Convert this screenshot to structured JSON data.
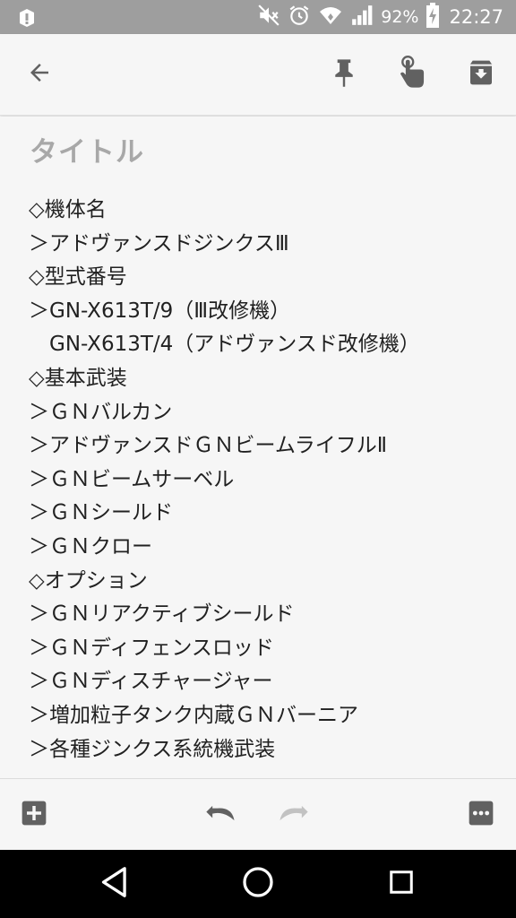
{
  "status_bar": {
    "battery_percent": "92%",
    "time": "22:27",
    "icons": [
      "notification-icon",
      "mute-icon",
      "alarm-icon",
      "wifi-icon",
      "signal-icon",
      "battery-charging-icon"
    ]
  },
  "toolbar": {
    "icons": [
      "back-arrow-icon",
      "pin-icon",
      "reminder-hand-icon",
      "archive-icon"
    ]
  },
  "note": {
    "title_placeholder": "タイトル",
    "lines": [
      "◇機体名",
      "＞アドヴァンスドジンクスⅢ",
      "◇型式番号",
      "＞GN-X613T/9（Ⅲ改修機）",
      "　GN-X613T/4（アドヴァンスド改修機）",
      "◇基本武装",
      "＞ＧＮバルカン",
      "＞アドヴァンスドＧＮビームライフルⅡ",
      "＞ＧＮビームサーベル",
      "＞ＧＮシールド",
      "＞ＧＮクロー",
      "◇オプション",
      "＞ＧＮリアクティブシールド",
      "＞ＧＮディフェンスロッド",
      "＞ＧＮディスチャージャー",
      "＞増加粒子タンク内蔵ＧＮバーニア",
      "＞各種ジンクス系統機武装"
    ]
  },
  "bottom_bar": {
    "icons": [
      "add-box-icon",
      "undo-icon",
      "redo-icon",
      "more-icon"
    ]
  },
  "nav_bar": {
    "icons": [
      "nav-back-icon",
      "nav-home-icon",
      "nav-recents-icon"
    ]
  },
  "colors": {
    "status_bar_bg": "#9e9e9e",
    "background": "#f6f6f6",
    "icon": "#616161",
    "text": "#212121",
    "placeholder": "#a8a8a8"
  }
}
